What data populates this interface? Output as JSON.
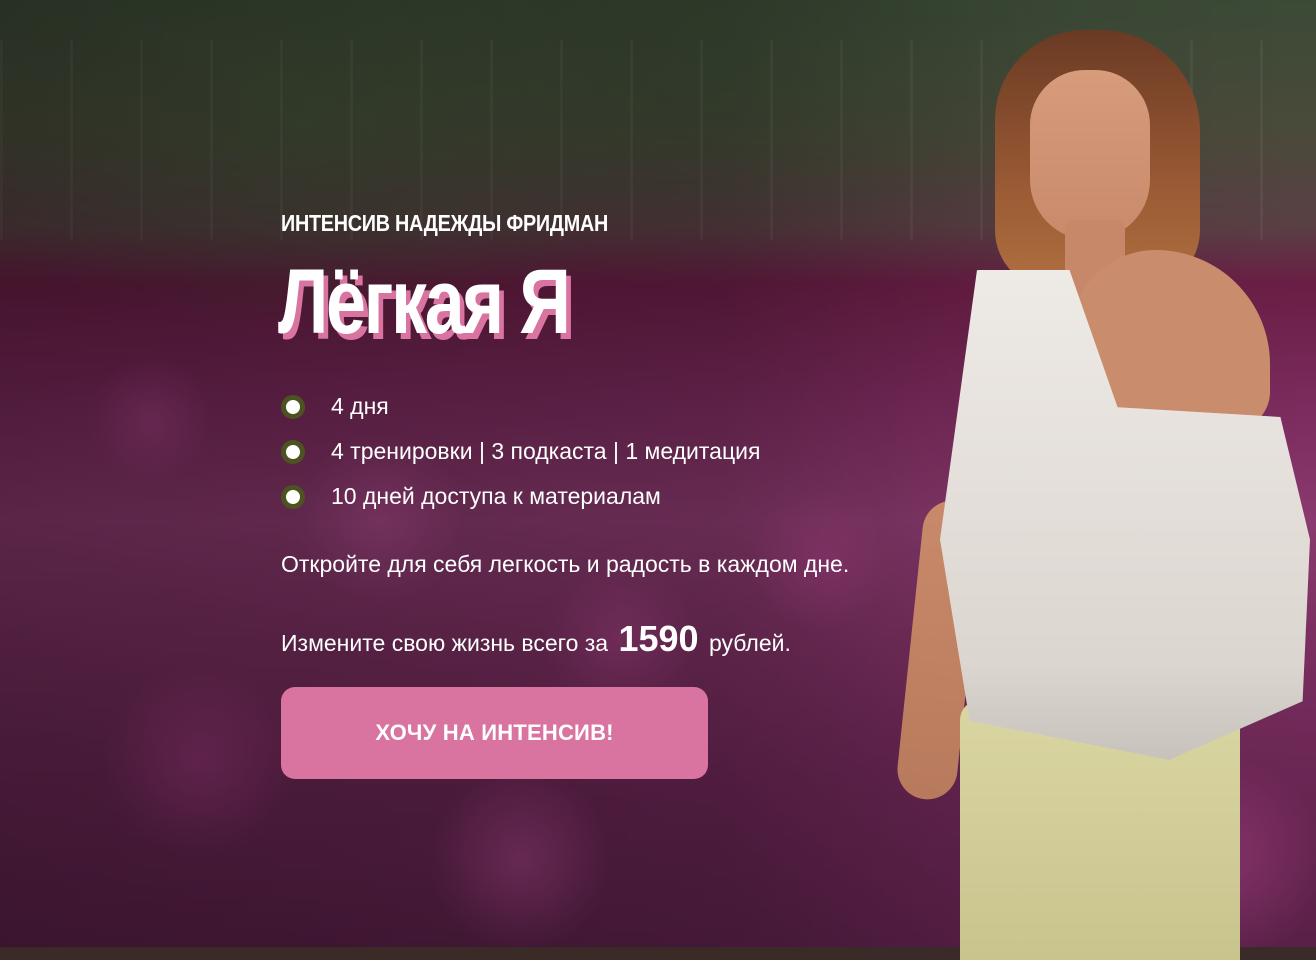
{
  "hero": {
    "eyebrow": "ИНТЕНСИВ НАДЕЖДЫ ФРИДМАН",
    "title": "Лёгкая Я",
    "features": [
      "4 дня",
      "4 тренировки | 3 подкаста | 1 медитация",
      "10 дней доступа к материалам"
    ],
    "tagline": "Откройте для себя легкость и радость в каждом дне.",
    "price": {
      "prefix": "Измените свою жизнь всего за",
      "amount": "1590",
      "suffix": "рублей."
    },
    "cta_label": "ХОЧУ НА ИНТЕНСИВ!"
  },
  "colors": {
    "accent": "#d9739f",
    "bullet_ring": "#4d5320",
    "text": "#ffffff"
  }
}
